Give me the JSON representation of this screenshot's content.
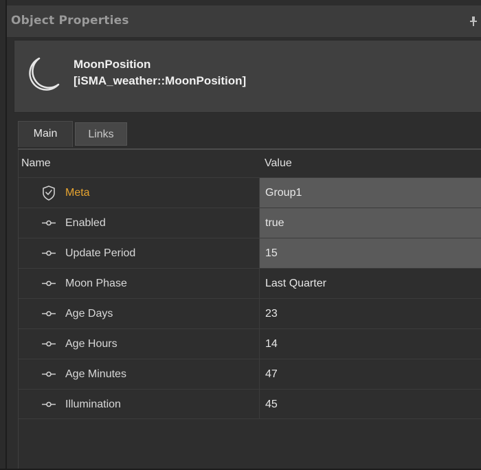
{
  "window": {
    "title": "Object Properties",
    "pin_icon": "pin-icon"
  },
  "object": {
    "icon": "moon-icon",
    "name": "MoonPosition",
    "type": "[iSMA_weather::MoonPosition]"
  },
  "tabs": [
    {
      "label": "Main",
      "active": true
    },
    {
      "label": "Links",
      "active": false
    }
  ],
  "grid": {
    "columns": {
      "name": "Name",
      "value": "Value"
    },
    "rows": [
      {
        "icon": "shield-check-icon",
        "name": "Meta",
        "value": "Group1",
        "editable": true,
        "highlight": "#e8a530"
      },
      {
        "icon": "slot-icon",
        "name": "Enabled",
        "value": "true",
        "editable": true
      },
      {
        "icon": "slot-icon",
        "name": "Update Period",
        "value": "15",
        "editable": true
      },
      {
        "icon": "slot-icon",
        "name": "Moon Phase",
        "value": "Last Quarter",
        "editable": false
      },
      {
        "icon": "slot-icon",
        "name": "Age Days",
        "value": "23",
        "editable": false
      },
      {
        "icon": "slot-icon",
        "name": "Age Hours",
        "value": "14",
        "editable": false
      },
      {
        "icon": "slot-icon",
        "name": "Age Minutes",
        "value": "47",
        "editable": false
      },
      {
        "icon": "slot-icon",
        "name": "Illumination",
        "value": "45",
        "editable": false
      }
    ]
  },
  "colors": {
    "background": "#2d2d2d",
    "meta_label": "#e8a530",
    "editable_value_bg": "#5a5a5a"
  }
}
